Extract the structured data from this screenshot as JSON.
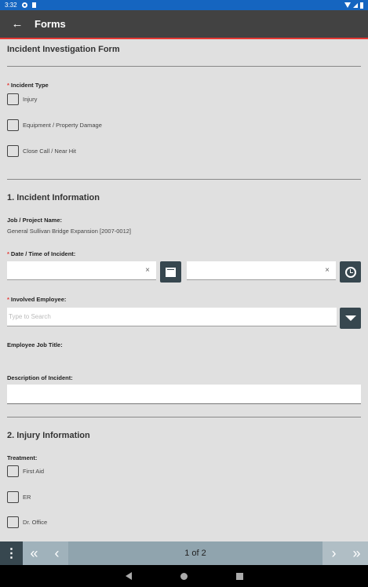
{
  "status": {
    "time": "3:32"
  },
  "header": {
    "title": "Forms",
    "back_glyph": "←"
  },
  "form": {
    "title": "Incident Investigation Form",
    "incident_type": {
      "label": "Incident Type",
      "options": [
        "Injury",
        "Equipment / Property Damage",
        "Close Call / Near Hit"
      ]
    },
    "section1": {
      "title": "1. Incident Information",
      "job_label": "Job / Project Name:",
      "job_value": "General Sullivan Bridge Expansion [2007-0012]",
      "datetime_label": "Date / Time of Incident:",
      "date_value": "",
      "time_value": "",
      "clear_glyph": "×",
      "employee_label": "Involved Employee:",
      "employee_placeholder": "Type to Search",
      "job_title_label": "Employee Job Title:",
      "description_label": "Description of Incident:"
    },
    "section2": {
      "title": "2. Injury Information",
      "treatment_label": "Treatment:",
      "options": [
        "First Aid",
        "ER",
        "Dr. Office"
      ]
    }
  },
  "pager": {
    "text": "1  of  2",
    "menu_glyph": "⋮",
    "first_glyph": "«",
    "prev_glyph": "‹",
    "next_glyph": "›",
    "last_glyph": "»"
  }
}
